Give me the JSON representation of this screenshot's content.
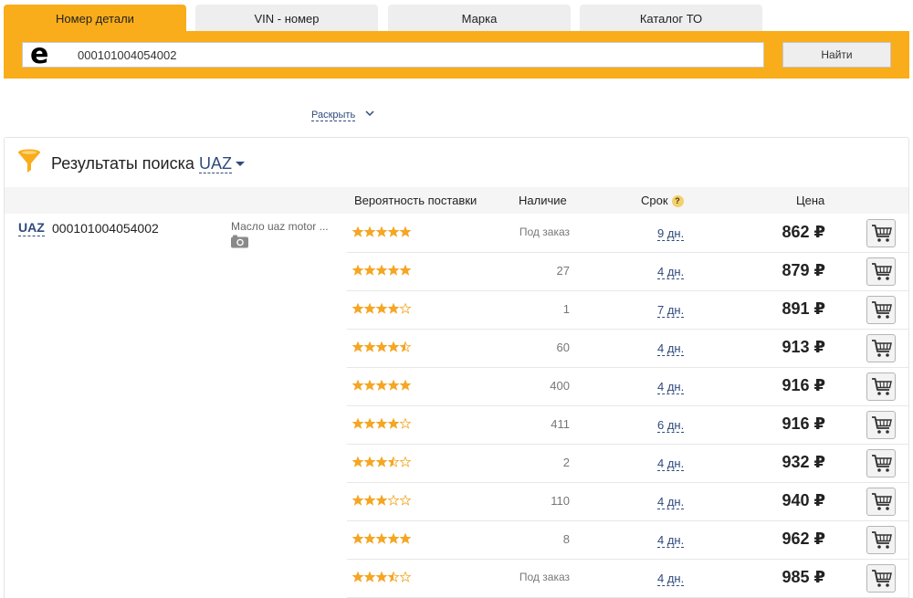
{
  "tabs": [
    {
      "label": "Номер детали",
      "active": true
    },
    {
      "label": "VIN - номер",
      "active": false
    },
    {
      "label": "Марка",
      "active": false
    },
    {
      "label": "Каталог ТО",
      "active": false
    }
  ],
  "search": {
    "logo": "e",
    "value": "000101004054002",
    "button": "Найти"
  },
  "expand_label": "Раскрыть",
  "results": {
    "title": "Результаты поиска",
    "brand_filter": "UAZ",
    "columns": {
      "probability": "Вероятность поставки",
      "availability": "Наличие",
      "term": "Срок",
      "price": "Цена"
    },
    "part": {
      "brand": "UAZ",
      "number": "000101004054002",
      "description": "Масло uaz motor ...",
      "has_photo": true
    },
    "offers": [
      {
        "rating": 5,
        "availability": "Под заказ",
        "term": "9 дн.",
        "price": "862 ₽"
      },
      {
        "rating": 5,
        "availability": "27",
        "term": "4 дн.",
        "price": "879 ₽"
      },
      {
        "rating": 4,
        "availability": "1",
        "term": "7 дн.",
        "price": "891 ₽"
      },
      {
        "rating": 4.5,
        "availability": "60",
        "term": "4 дн.",
        "price": "913 ₽"
      },
      {
        "rating": 5,
        "availability": "400",
        "term": "4 дн.",
        "price": "916 ₽"
      },
      {
        "rating": 4,
        "availability": "411",
        "term": "6 дн.",
        "price": "916 ₽"
      },
      {
        "rating": 3.5,
        "availability": "2",
        "term": "4 дн.",
        "price": "932 ₽"
      },
      {
        "rating": 3,
        "availability": "110",
        "term": "4 дн.",
        "price": "940 ₽"
      },
      {
        "rating": 5,
        "availability": "8",
        "term": "4 дн.",
        "price": "962 ₽"
      },
      {
        "rating": 3.5,
        "availability": "Под заказ",
        "term": "4 дн.",
        "price": "985 ₽"
      }
    ]
  },
  "colors": {
    "accent": "#f9ad1a",
    "link": "#2e4a7d",
    "star": "#f5a623"
  }
}
